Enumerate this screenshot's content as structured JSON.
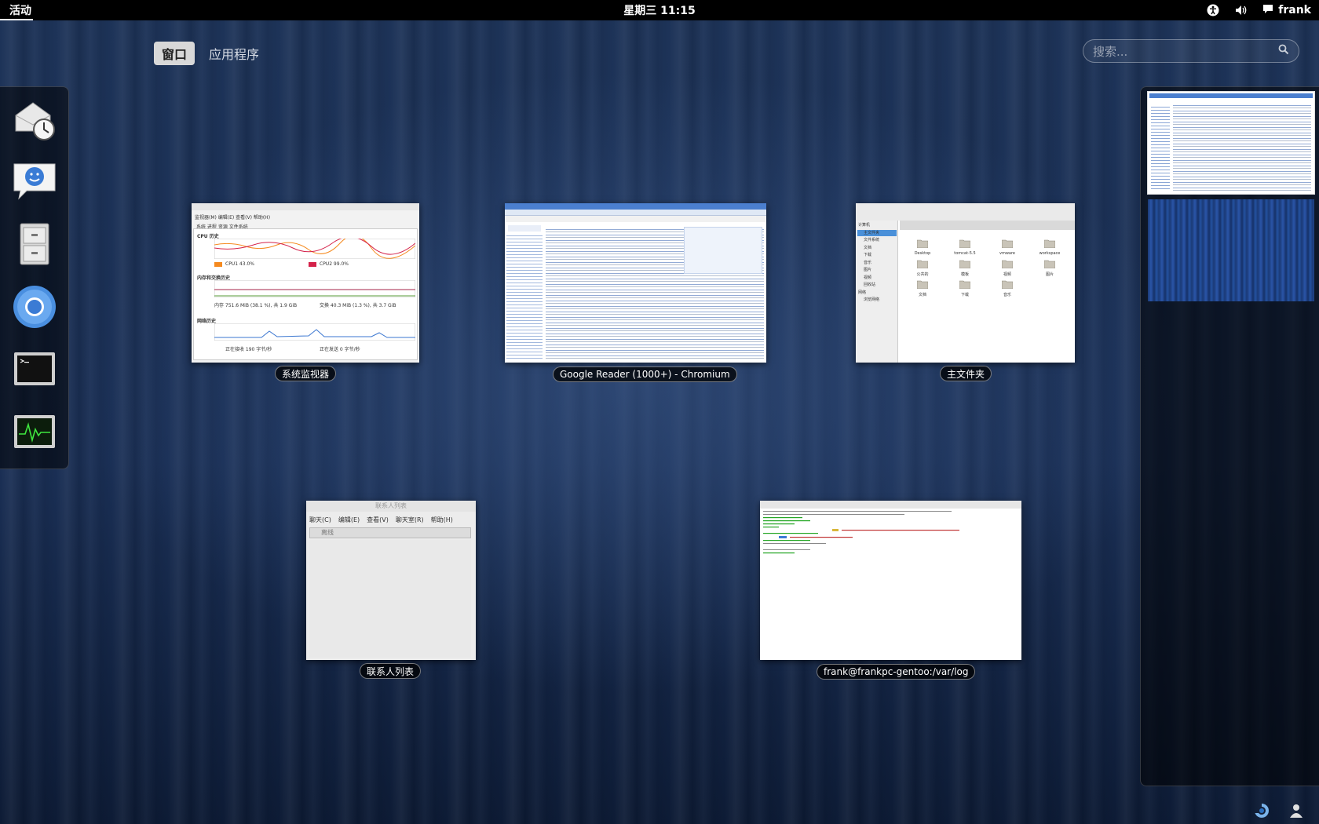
{
  "top_panel": {
    "activities_label": "活动",
    "clock": "星期三 11:15",
    "user_name": "frank",
    "status_icons": [
      "accessibility-icon",
      "volume-icon",
      "chat-icon"
    ]
  },
  "view_selector": {
    "windows_tab": "窗口",
    "applications_tab": "应用程序"
  },
  "search": {
    "placeholder": "搜索..."
  },
  "dash": {
    "items": [
      {
        "name": "evolution-mail-calendar-icon"
      },
      {
        "name": "empathy-chat-icon"
      },
      {
        "name": "file-cabinet-icon"
      },
      {
        "name": "chromium-icon"
      },
      {
        "name": "terminal-icon"
      },
      {
        "name": "system-monitor-icon"
      }
    ]
  },
  "windows": {
    "sysmon": {
      "caption": "系统监视器",
      "menu": "监视器(M)  编辑(E)  查看(V)  帮助(H)",
      "tabs": "系统  进程  资源  文件系统",
      "cpu_title": "CPU 历史",
      "cpu1": "CPU1 43.0%",
      "cpu2": "CPU2 99.0%",
      "mem_title": "内存和交换历史",
      "mem": "内存 751.6 MiB (38.1 %), 共 1.9 GiB",
      "swap": "交换 40.3 MiB (1.3 %), 共 3.7 GiB",
      "net_title": "网络历史",
      "recv": "正在接收 190 字节/秒",
      "sent": "正在发送 0 字节/秒"
    },
    "chromium": {
      "caption": "Google Reader (1000+) - Chromium"
    },
    "files": {
      "caption": "主文件夹",
      "folders": [
        "Desktop",
        "tomcat-5.5",
        "vmware",
        "workspace",
        "公共的",
        "模板",
        "视频",
        "图片",
        "文档",
        "下载",
        "音乐"
      ],
      "sidebar": [
        "计算机",
        "主文件夹",
        "文件系统",
        "文档",
        "下载",
        "音乐",
        "图片",
        "视频",
        "回收站",
        "网络",
        "浏览网络"
      ]
    },
    "contacts": {
      "caption": "联系人列表",
      "title": "联系人列表",
      "menu": [
        "聊天(C)",
        "编辑(E)",
        "查看(V)",
        "聊天室(R)",
        "帮助(H)"
      ],
      "status": "离线"
    },
    "terminal": {
      "caption": "frank@frankpc-gentoo:/var/log"
    }
  },
  "colors": {
    "panel_bg": "#000000",
    "accent": "#d8d8d8",
    "background": "#1a2f55"
  }
}
